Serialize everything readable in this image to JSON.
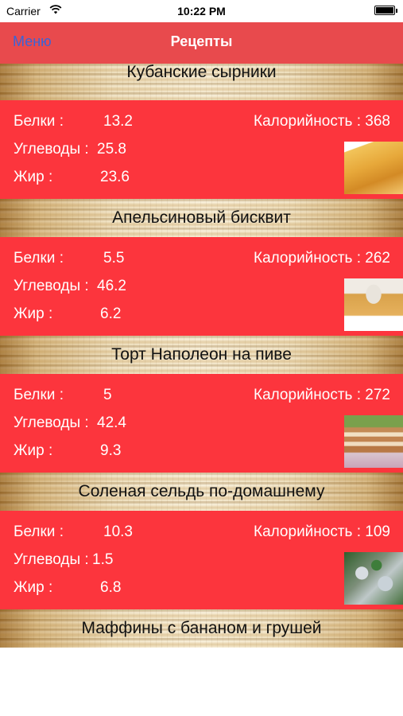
{
  "status_bar": {
    "carrier": "Carrier",
    "time": "10:22 PM"
  },
  "nav": {
    "menu_label": "Меню",
    "title": "Рецепты"
  },
  "recipes": [
    {
      "name": "Кубанские сырники",
      "protein_label": "Белки :",
      "protein": "13.2",
      "carbs_label": "Углеводы :",
      "carbs": "25.8",
      "fat_label": "Жир :",
      "fat": "23.6",
      "calories_label": "Калорийность : 368",
      "image_icon": "pie-photo"
    },
    {
      "name": "Апельсиновый бисквит",
      "protein_label": "Белки :",
      "protein": "5.5",
      "carbs_label": "Углеводы :",
      "carbs": "46.2",
      "fat_label": "Жир :",
      "fat": "6.2",
      "calories_label": "Калорийность : 262",
      "image_icon": "sponge-cake-photo"
    },
    {
      "name": "Торт Наполеон на пиве",
      "protein_label": "Белки :",
      "protein": "5",
      "carbs_label": "Углеводы :",
      "carbs": "42.4",
      "fat_label": "Жир :",
      "fat": "9.3",
      "calories_label": "Калорийность : 272",
      "image_icon": "napoleon-cake-photo"
    },
    {
      "name": "Соленая сельдь по-домашнему",
      "protein_label": "Белки :",
      "protein": "10.3",
      "carbs_label": "Углеводы :",
      "carbs": "1.5",
      "fat_label": "Жир :",
      "fat": "6.8",
      "calories_label": "Калорийность : 109",
      "image_icon": "herring-photo"
    },
    {
      "name": "Маффины с бананом и грушей"
    }
  ],
  "colors": {
    "nav_bar": "#e84a4d",
    "card": "#fc353d",
    "menu_link": "#3a63d8"
  }
}
